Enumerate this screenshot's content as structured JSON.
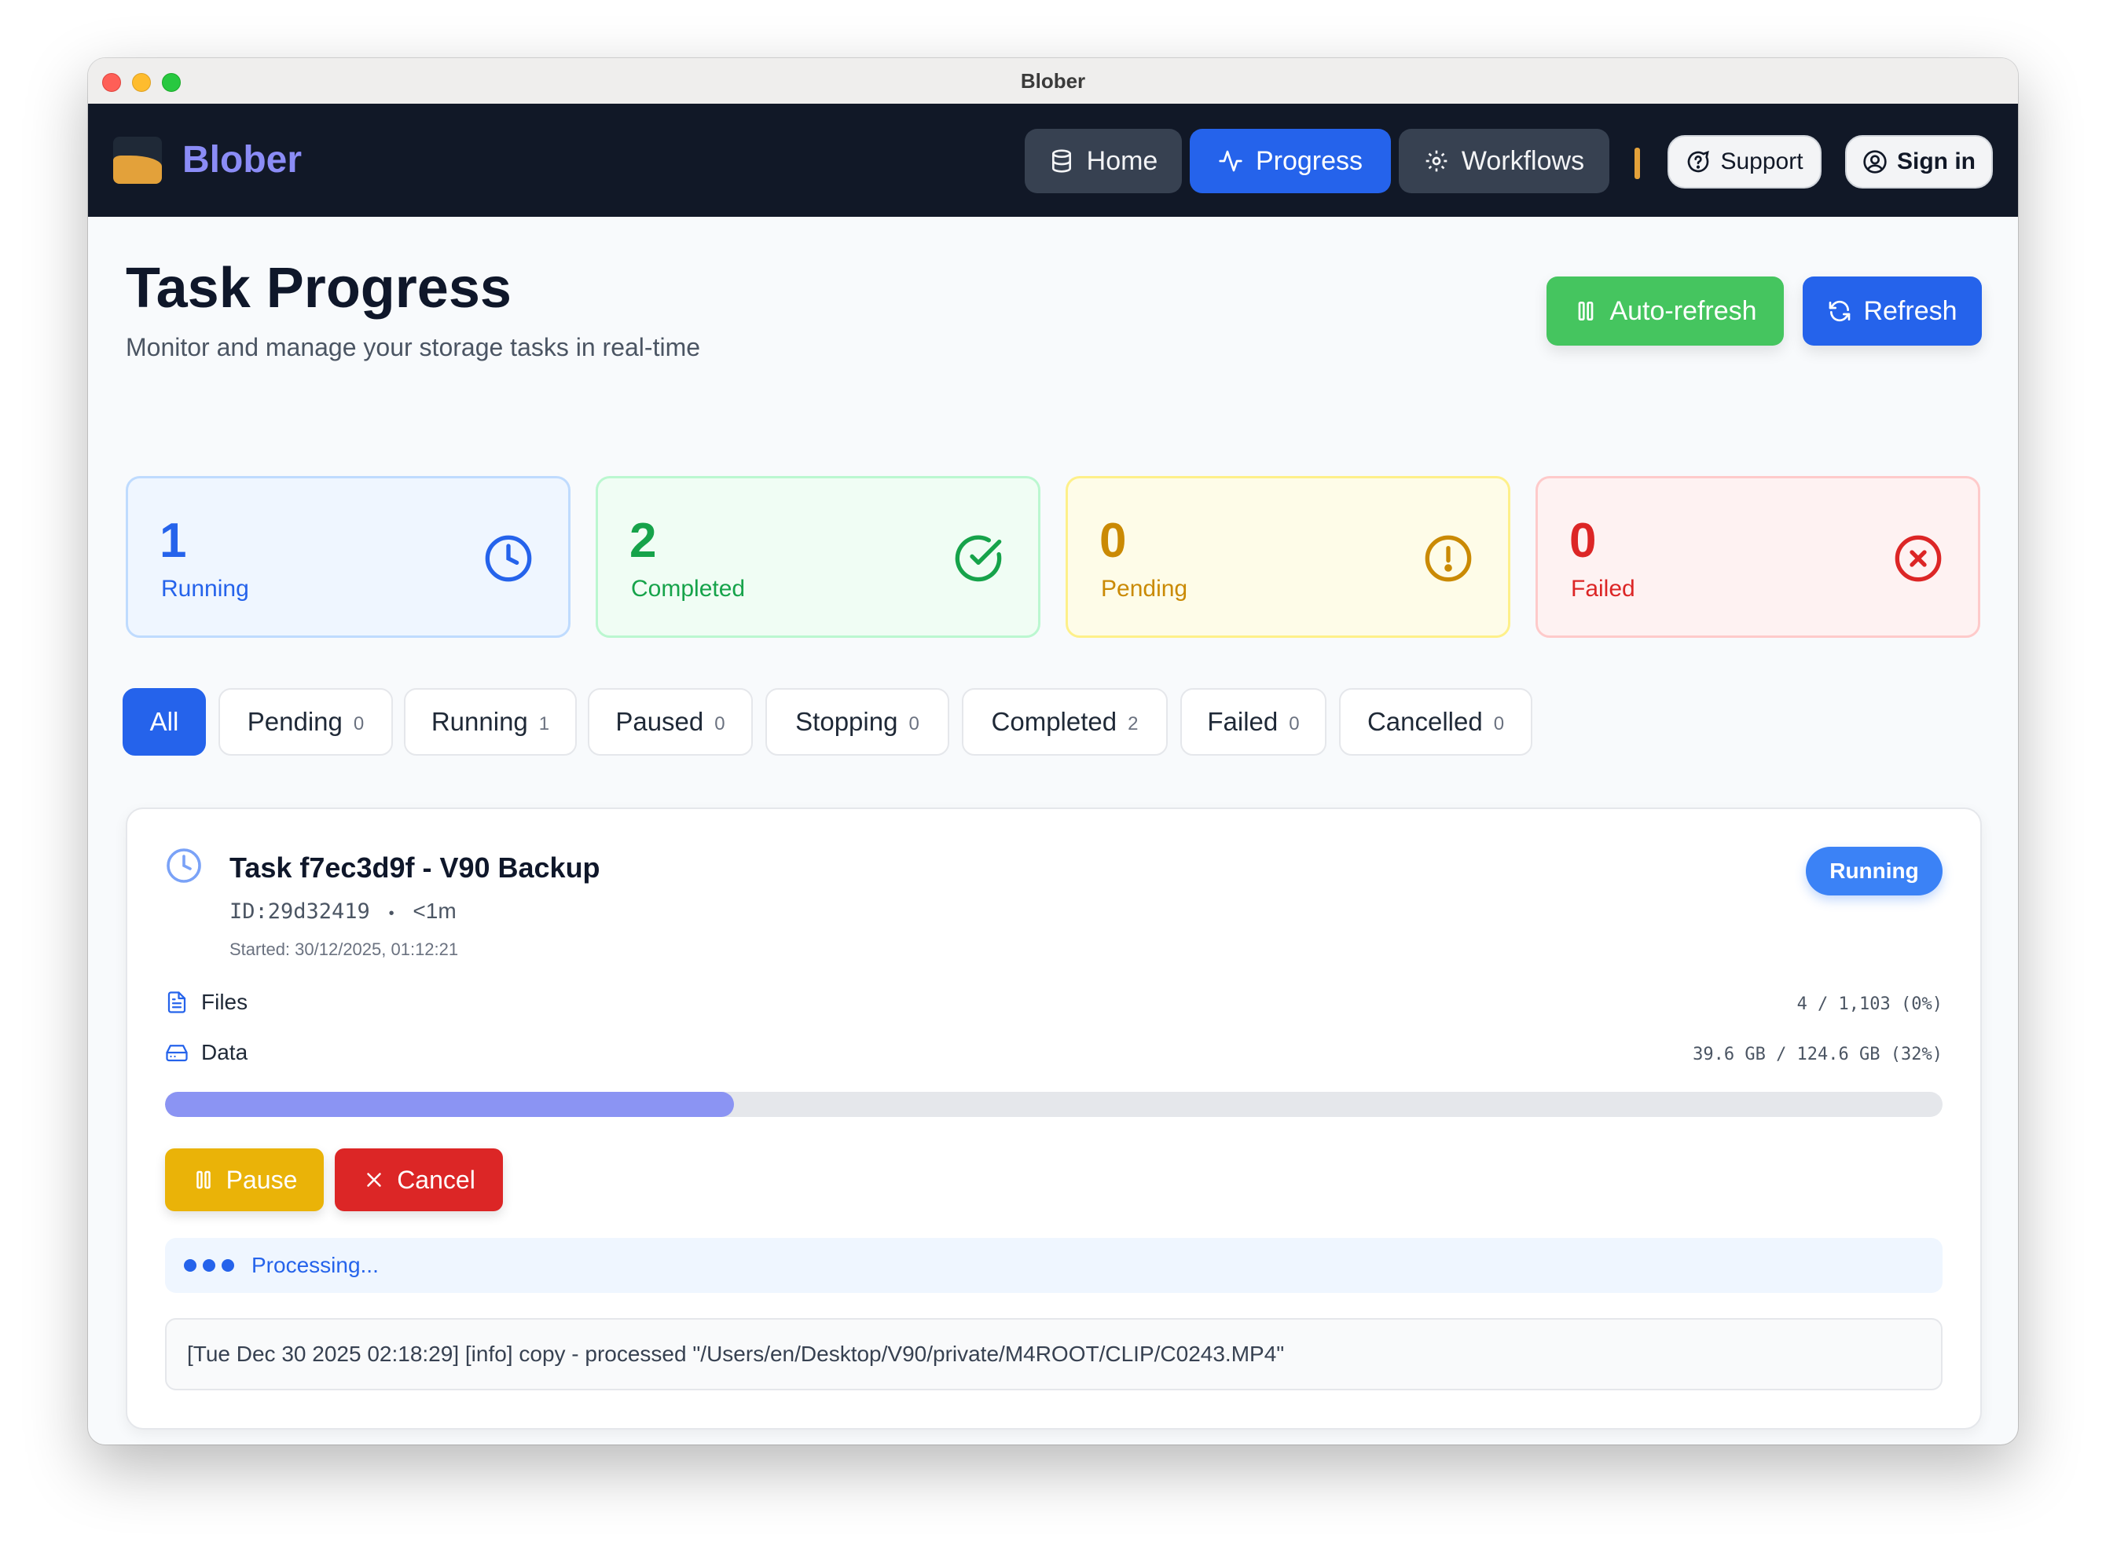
{
  "window": {
    "title": "Blober"
  },
  "navbar": {
    "brand": "Blober",
    "items": [
      {
        "label": "Home",
        "icon": "database-icon"
      },
      {
        "label": "Progress",
        "icon": "activity-icon",
        "active": true
      },
      {
        "label": "Workflows",
        "icon": "gear-icon"
      }
    ],
    "support_label": "Support",
    "signin_label": "Sign in"
  },
  "header": {
    "title": "Task Progress",
    "subtitle": "Monitor and manage your storage tasks in real-time",
    "auto_refresh_label": "Auto-refresh",
    "refresh_label": "Refresh"
  },
  "stats": [
    {
      "value": "1",
      "label": "Running",
      "icon": "clock-icon",
      "color": "#2563eb"
    },
    {
      "value": "2",
      "label": "Completed",
      "icon": "check-circle-icon",
      "color": "#16a34a"
    },
    {
      "value": "0",
      "label": "Pending",
      "icon": "alert-circle-icon",
      "color": "#ca8a04"
    },
    {
      "value": "0",
      "label": "Failed",
      "icon": "x-circle-icon",
      "color": "#dc2626"
    }
  ],
  "filters": [
    {
      "label": "All",
      "count": "",
      "active": true
    },
    {
      "label": "Pending",
      "count": "0"
    },
    {
      "label": "Running",
      "count": "1"
    },
    {
      "label": "Paused",
      "count": "0"
    },
    {
      "label": "Stopping",
      "count": "0"
    },
    {
      "label": "Completed",
      "count": "2"
    },
    {
      "label": "Failed",
      "count": "0"
    },
    {
      "label": "Cancelled",
      "count": "0"
    }
  ],
  "task": {
    "title": "Task f7ec3d9f - V90 Backup",
    "id": "ID:29d32419",
    "separator": "•",
    "duration": "<1m",
    "started": "Started: 30/12/2025, 01:12:21",
    "status": "Running",
    "files_label": "Files",
    "files_value": "4 / 1,103 (0%)",
    "data_label": "Data",
    "data_value": "39.6 GB / 124.6 GB (32%)",
    "progress_fraction": 0.32,
    "pause_label": "Pause",
    "cancel_label": "Cancel",
    "processing_text": "Processing...",
    "log": "[Tue Dec 30 2025 02:18:29] [info] copy - processed \"/Users/en/Desktop/V90/private/M4ROOT/CLIP/C0243.MP4\""
  },
  "colors": {
    "accent": "#2563eb",
    "navbar_bg": "#111827",
    "brand": "#8b8cf6",
    "success": "#45c55f",
    "warning": "#eab308",
    "danger": "#dc2626",
    "progress_fill": "#8b94f3"
  }
}
